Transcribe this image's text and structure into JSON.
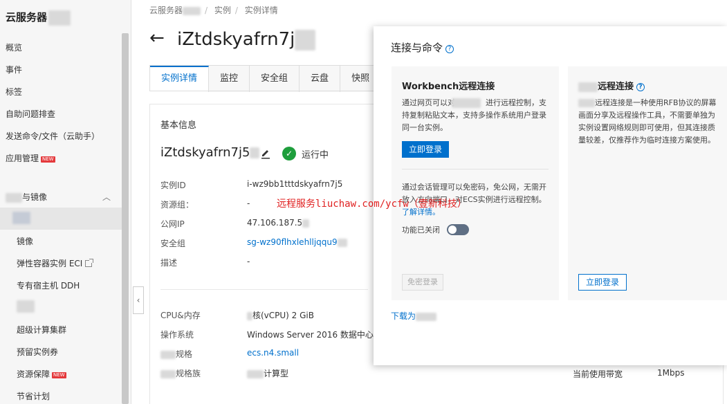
{
  "sidebar": {
    "title": "云服务器",
    "items": [
      {
        "label": "概览"
      },
      {
        "label": "事件"
      },
      {
        "label": "标签"
      },
      {
        "label": "自助问题排查"
      },
      {
        "label": "发送命令/文件（云助手）"
      },
      {
        "label": "应用管理",
        "badge": "NEW"
      }
    ],
    "section_label": "与镜像",
    "sub_items": [
      {
        "label": "镜像"
      },
      {
        "label": "弹性容器实例 ECI"
      },
      {
        "label": "专有宿主机 DDH"
      },
      {
        "label": "超级计算集群"
      },
      {
        "label": "预留实例券"
      },
      {
        "label": "资源保障",
        "badge": "NEW"
      },
      {
        "label": "节省计划"
      }
    ]
  },
  "breadcrumb": [
    "云服务器",
    "实例",
    "实例详情"
  ],
  "page_title": "iZtdskyafrn7j",
  "tabs": [
    "实例详情",
    "监控",
    "安全组",
    "云盘",
    "快照"
  ],
  "basic_info": {
    "section_title": "基本信息",
    "instance_name": "iZtdskyafrn7j5",
    "status": "运行中",
    "rows": [
      {
        "label": "实例ID",
        "value": "i-wz9bb1tttdskyafrn7j5"
      },
      {
        "label": "资源组：",
        "value": "-"
      },
      {
        "label": "公网IP",
        "value": "47.106.187.5"
      },
      {
        "label": "安全组",
        "value": "sg-wz90flhxlehlljqqu9"
      },
      {
        "label": "描述",
        "value": "-"
      }
    ],
    "rows2": [
      {
        "label": "CPU&内存",
        "value": "核(vCPU) 2 GiB"
      },
      {
        "label": "操作系统",
        "value": "Windows Server 2016 数据中心版"
      },
      {
        "label": "规格",
        "value": "ecs.n4.small"
      },
      {
        "label": "规格族",
        "value": "计算型"
      }
    ],
    "bandwidth_label": "当前使用带宽",
    "bandwidth_value": "1Mbps"
  },
  "modal": {
    "title": "连接与命令",
    "workbench": {
      "title": "Workbench远程连接",
      "text": "通过网页可以对　　　　进行远程控制，支持复制粘贴文本，支持多操作系统用户登录同一台实例。",
      "button": "立即登录",
      "session_text": "通过会话管理可以免密码，免公网，无需开放入方向端口，对ECS实例进行远程控制。",
      "learn_more": "了解详情。",
      "toggle_label": "功能已关闭",
      "disabled_button": "免密登录"
    },
    "vnc": {
      "title": "远程连接",
      "text": "远程连接是一种使用RFB协议的屏幕画面分享及远程操作工具，不需要单独为实例设置网络规则即可使用，但其连接质量较差，仅推荐作为临时连接方案使用。",
      "button": "立即登录"
    },
    "download": "下载为"
  },
  "watermark": "远程服务liuchaw.com/ycfw（壹新科技）"
}
